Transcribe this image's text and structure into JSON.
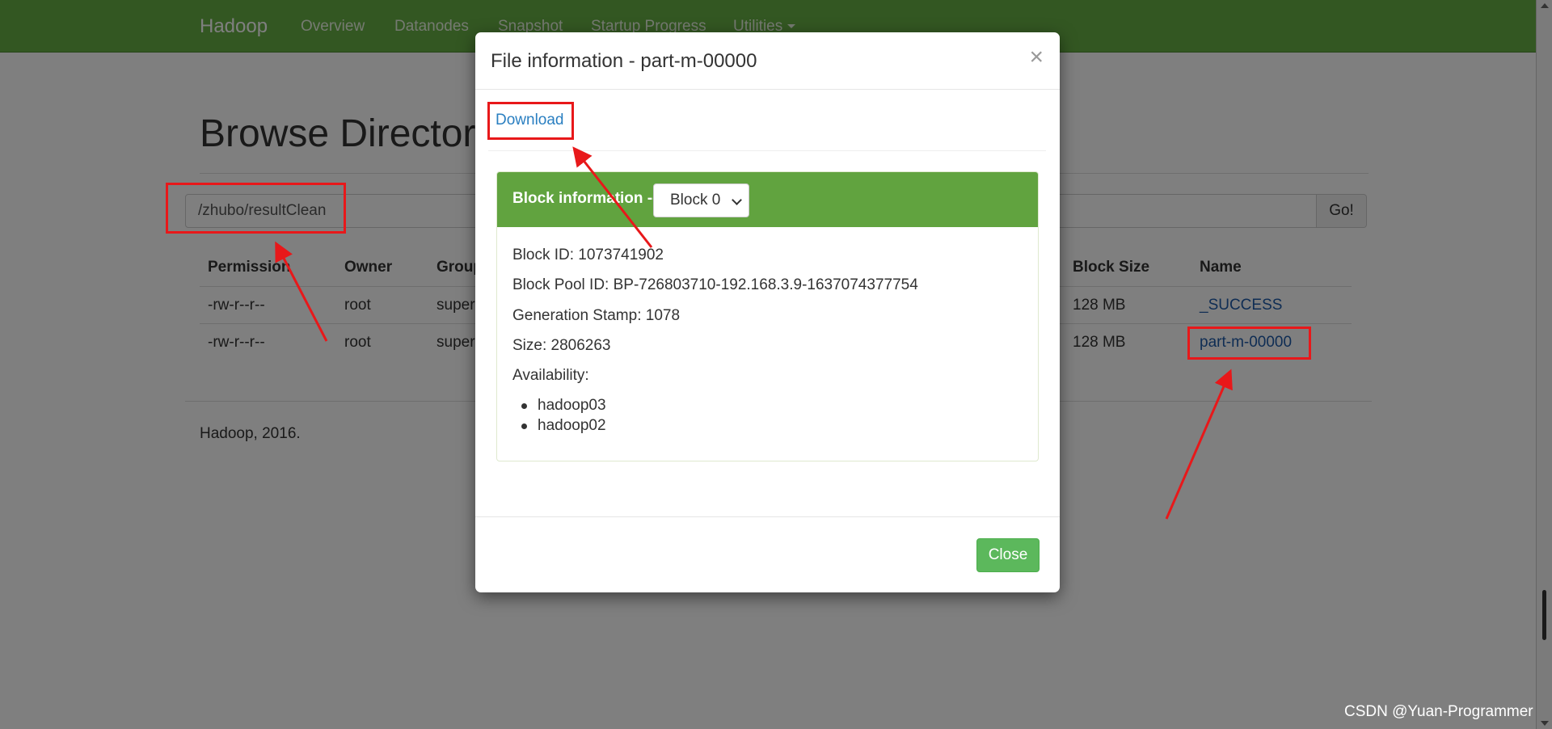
{
  "navbar": {
    "brand": "Hadoop",
    "items": [
      "Overview",
      "Datanodes",
      "Snapshot",
      "Startup Progress",
      "Utilities"
    ]
  },
  "page": {
    "title": "Browse Directory",
    "path_value": "/zhubo/resultClean",
    "go_label": "Go!",
    "columns": [
      "Permission",
      "Owner",
      "Group",
      "Block Size",
      "Name"
    ],
    "rows": [
      {
        "permission": "-rw-r--r--",
        "owner": "root",
        "group": "super",
        "block_size": "128 MB",
        "name": "_SUCCESS"
      },
      {
        "permission": "-rw-r--r--",
        "owner": "root",
        "group": "super",
        "block_size": "128 MB",
        "name": "part-m-00000"
      }
    ],
    "footer": "Hadoop, 2016."
  },
  "modal": {
    "title": "File information - part-m-00000",
    "close_symbol": "×",
    "download_label": "Download",
    "block_heading": "Block information --",
    "block_selected": "Block 0",
    "block_id": "Block ID: 1073741902",
    "block_pool_id": "Block Pool ID: BP-726803710-192.168.3.9-1637074377754",
    "generation_stamp": "Generation Stamp: 1078",
    "size": "Size: 2806263",
    "availability_label": "Availability:",
    "availability": [
      "hadoop03",
      "hadoop02"
    ],
    "close_label": "Close"
  },
  "watermark": "CSDN @Yuan-Programmer",
  "colors": {
    "navbar": "#67ae44",
    "panel_heading": "#61a33f",
    "close_button": "#5cb85c",
    "link": "#2a7fc1",
    "annotation_red": "#e8181a"
  }
}
